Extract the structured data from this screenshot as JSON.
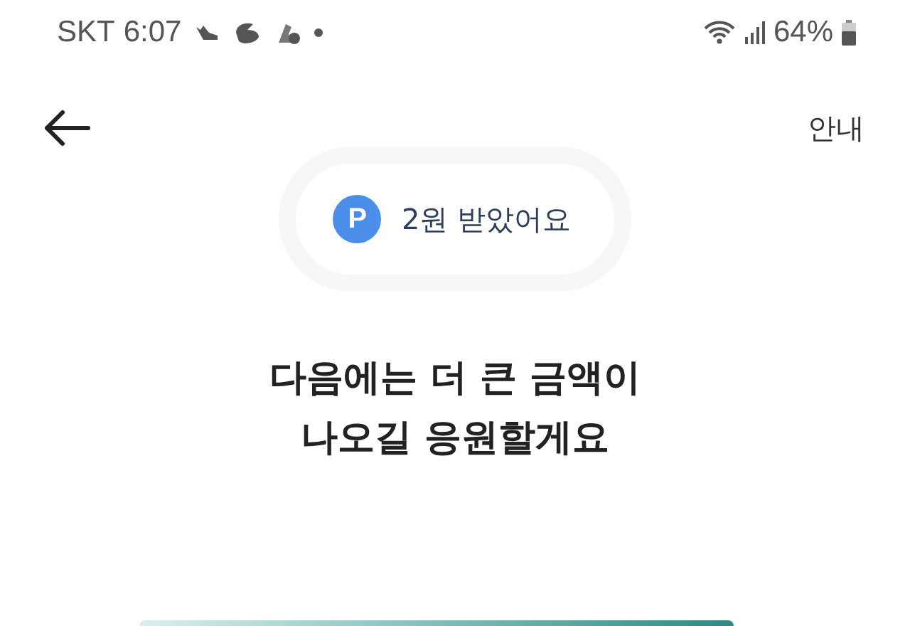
{
  "status_bar": {
    "carrier": "SKT",
    "time": "6:07",
    "battery": "64%"
  },
  "header": {
    "help_link": "안내"
  },
  "reward_pill": {
    "badge": "P",
    "text": "2원 받았어요"
  },
  "message": {
    "lines": [
      "다음에는 더 큰 금액이",
      "나오길 응원할게요"
    ]
  }
}
